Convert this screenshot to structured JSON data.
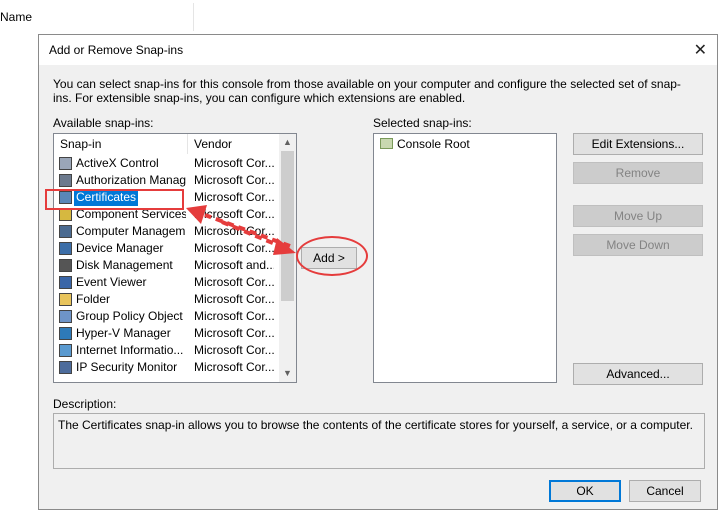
{
  "background": {
    "column_header": "Name"
  },
  "dialog": {
    "title": "Add or Remove Snap-ins",
    "intro": "You can select snap-ins for this console from those available on your computer and configure the selected set of snap-ins. For extensible snap-ins, you can configure which extensions are enabled.",
    "available_label": "Available snap-ins:",
    "selected_label": "Selected snap-ins:",
    "columns": {
      "snapin": "Snap-in",
      "vendor": "Vendor"
    },
    "snapins": [
      {
        "name": "ActiveX Control",
        "vendor": "Microsoft Cor...",
        "icon": "activex-icon"
      },
      {
        "name": "Authorization Manager",
        "vendor": "Microsoft Cor...",
        "icon": "authorization-icon"
      },
      {
        "name": "Certificates",
        "vendor": "Microsoft Cor...",
        "icon": "certificates-icon",
        "selected": true
      },
      {
        "name": "Component Services",
        "vendor": "Microsoft Cor...",
        "icon": "component-services-icon"
      },
      {
        "name": "Computer Managem...",
        "vendor": "Microsoft Cor...",
        "icon": "computer-management-icon"
      },
      {
        "name": "Device Manager",
        "vendor": "Microsoft Cor...",
        "icon": "device-manager-icon"
      },
      {
        "name": "Disk Management",
        "vendor": "Microsoft and...",
        "icon": "disk-management-icon"
      },
      {
        "name": "Event Viewer",
        "vendor": "Microsoft Cor...",
        "icon": "event-viewer-icon"
      },
      {
        "name": "Folder",
        "vendor": "Microsoft Cor...",
        "icon": "folder-icon"
      },
      {
        "name": "Group Policy Object ...",
        "vendor": "Microsoft Cor...",
        "icon": "group-policy-icon"
      },
      {
        "name": "Hyper-V Manager",
        "vendor": "Microsoft Cor...",
        "icon": "hyperv-icon"
      },
      {
        "name": "Internet Informatio...",
        "vendor": "Microsoft Cor...",
        "icon": "iis-icon"
      },
      {
        "name": "IP Security Monitor",
        "vendor": "Microsoft Cor...",
        "icon": "ip-security-icon"
      }
    ],
    "selected_snapins": [
      {
        "name": "Console Root",
        "icon": "console-root-icon"
      }
    ],
    "buttons": {
      "add": "Add >",
      "edit_extensions": "Edit Extensions...",
      "remove": "Remove",
      "move_up": "Move Up",
      "move_down": "Move Down",
      "advanced": "Advanced...",
      "ok": "OK",
      "cancel": "Cancel"
    },
    "description_label": "Description:",
    "description": "The Certificates snap-in allows you to browse the contents of the certificate stores for yourself, a service, or a computer."
  },
  "colors": {
    "selection": "#0078d7",
    "annotation": "#e53c3c"
  }
}
